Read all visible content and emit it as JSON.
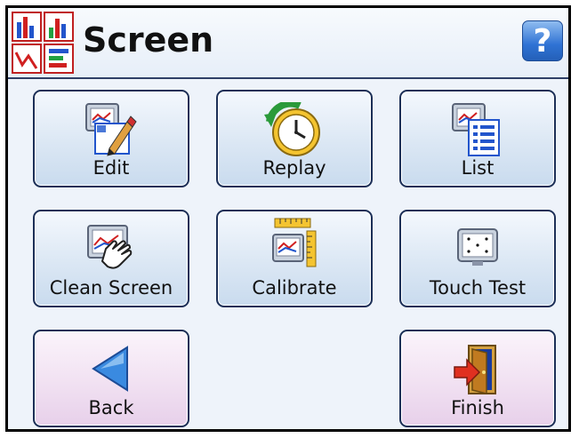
{
  "header": {
    "title": "Screen",
    "app_icon": "charts-app-icon",
    "help_label": "?"
  },
  "buttons": {
    "edit": {
      "label": "Edit",
      "icon": "edit-screen-icon"
    },
    "replay": {
      "label": "Replay",
      "icon": "replay-clock-icon"
    },
    "list": {
      "label": "List",
      "icon": "list-screen-icon"
    },
    "clean_screen": {
      "label": "Clean Screen",
      "icon": "clean-screen-hand-icon"
    },
    "calibrate": {
      "label": "Calibrate",
      "icon": "calibrate-ruler-icon"
    },
    "touch_test": {
      "label": "Touch Test",
      "icon": "touch-test-icon"
    },
    "back": {
      "label": "Back",
      "icon": "back-arrow-icon"
    },
    "finish": {
      "label": "Finish",
      "icon": "exit-door-icon"
    }
  },
  "colors": {
    "frame_border": "#000000",
    "header_rule": "#2f3f66",
    "button_border": "#1c2f57",
    "help_blue": "#2f72d4",
    "nav_button_pink": "#f1e1f2"
  }
}
